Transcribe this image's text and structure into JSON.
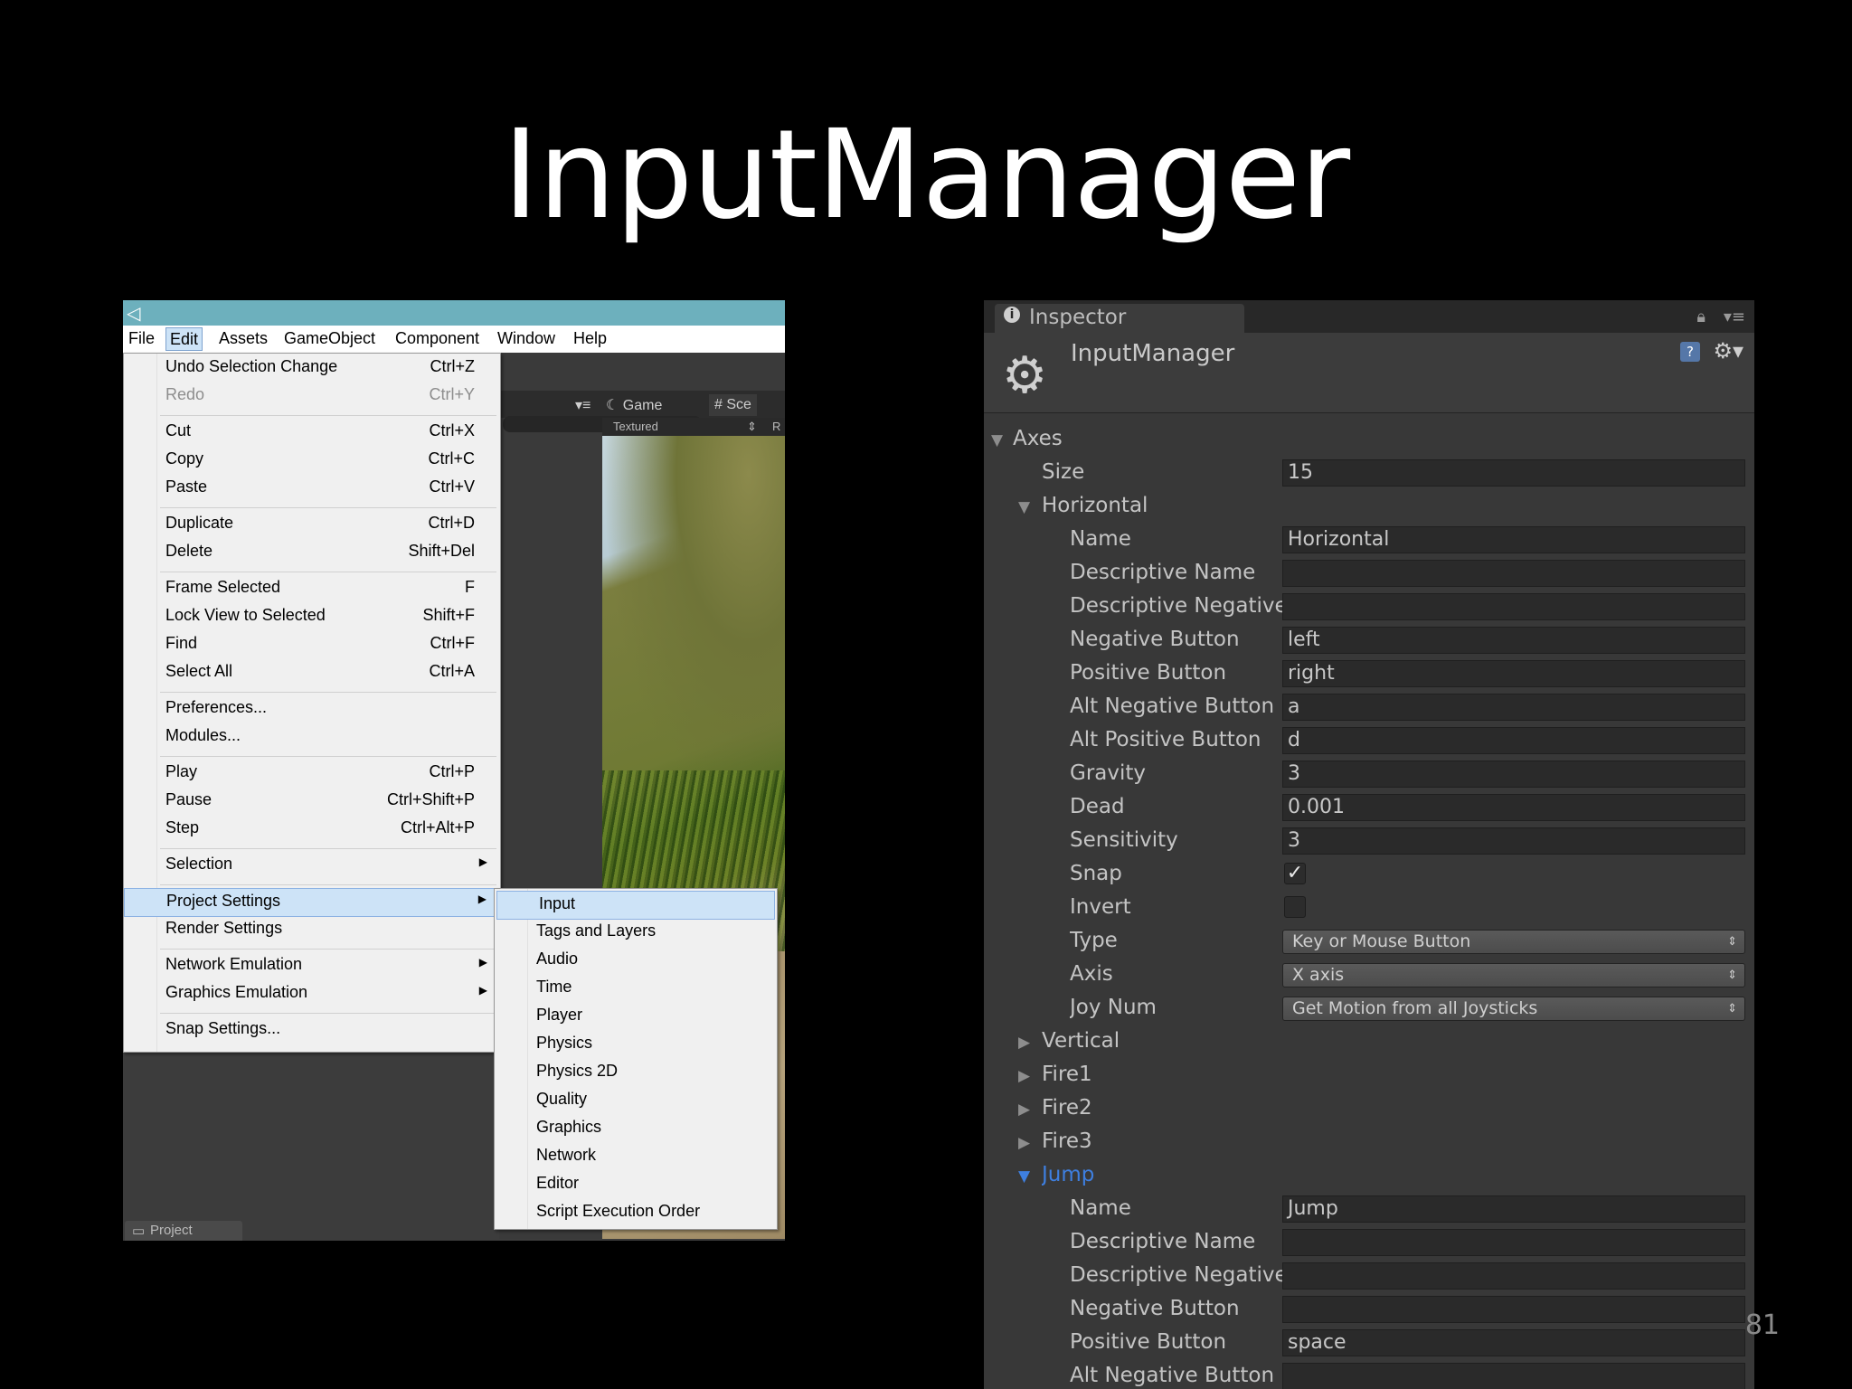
{
  "slide": {
    "title": "InputManager",
    "page_number": "81"
  },
  "unity_editor": {
    "menubar": [
      "File",
      "Edit",
      "Assets",
      "GameObject",
      "Component",
      "Window",
      "Help"
    ],
    "edit_menu": [
      {
        "label": "Undo Selection Change",
        "shortcut": "Ctrl+Z"
      },
      {
        "label": "Redo",
        "shortcut": "Ctrl+Y"
      },
      {
        "label": "Cut",
        "shortcut": "Ctrl+X"
      },
      {
        "label": "Copy",
        "shortcut": "Ctrl+C"
      },
      {
        "label": "Paste",
        "shortcut": "Ctrl+V"
      },
      {
        "label": "Duplicate",
        "shortcut": "Ctrl+D"
      },
      {
        "label": "Delete",
        "shortcut": "Shift+Del"
      },
      {
        "label": "Frame Selected",
        "shortcut": "F"
      },
      {
        "label": "Lock View to Selected",
        "shortcut": "Shift+F"
      },
      {
        "label": "Find",
        "shortcut": "Ctrl+F"
      },
      {
        "label": "Select All",
        "shortcut": "Ctrl+A"
      },
      {
        "label": "Preferences...",
        "shortcut": ""
      },
      {
        "label": "Modules...",
        "shortcut": ""
      },
      {
        "label": "Play",
        "shortcut": "Ctrl+P"
      },
      {
        "label": "Pause",
        "shortcut": "Ctrl+Shift+P"
      },
      {
        "label": "Step",
        "shortcut": "Ctrl+Alt+P"
      },
      {
        "label": "Selection",
        "shortcut": ""
      },
      {
        "label": "Project Settings",
        "shortcut": ""
      },
      {
        "label": "Render Settings",
        "shortcut": ""
      },
      {
        "label": "Network Emulation",
        "shortcut": ""
      },
      {
        "label": "Graphics Emulation",
        "shortcut": ""
      },
      {
        "label": "Snap Settings...",
        "shortcut": ""
      }
    ],
    "project_settings_menu": [
      "Input",
      "Tags and Layers",
      "Audio",
      "Time",
      "Player",
      "Physics",
      "Physics 2D",
      "Quality",
      "Graphics",
      "Network",
      "Editor",
      "Script Execution Order"
    ],
    "tabs": {
      "game": "Game",
      "scene": "Sce",
      "textured": "Textured",
      "r": "R"
    },
    "project_tab": "Project"
  },
  "inspector": {
    "tab_label": "Inspector",
    "object_name": "InputManager",
    "axes_label": "Axes",
    "size_label": "Size",
    "size_value": "15",
    "horizontal": {
      "header": "Horizontal",
      "name_label": "Name",
      "name": "Horizontal",
      "desc_name_label": "Descriptive Name",
      "desc_name": "",
      "desc_neg_label": "Descriptive Negative Name",
      "desc_neg": "",
      "neg_button_label": "Negative Button",
      "neg_button": "left",
      "pos_button_label": "Positive Button",
      "pos_button": "right",
      "alt_neg_label": "Alt Negative Button",
      "alt_neg": "a",
      "alt_pos_label": "Alt Positive Button",
      "alt_pos": "d",
      "gravity_label": "Gravity",
      "gravity": "3",
      "dead_label": "Dead",
      "dead": "0.001",
      "sensitivity_label": "Sensitivity",
      "sensitivity": "3",
      "snap_label": "Snap",
      "snap": true,
      "invert_label": "Invert",
      "invert": false,
      "type_label": "Type",
      "type": "Key or Mouse Button",
      "axis_label": "Axis",
      "axis": "X axis",
      "joy_label": "Joy Num",
      "joy": "Get Motion from all Joysticks"
    },
    "collapsed_axes": [
      "Vertical",
      "Fire1",
      "Fire2",
      "Fire3"
    ],
    "jump": {
      "header": "Jump",
      "name_label": "Name",
      "name": "Jump",
      "desc_name_label": "Descriptive Name",
      "desc_name": "",
      "desc_neg_label": "Descriptive Negative Name",
      "desc_neg": "",
      "neg_button_label": "Negative Button",
      "neg_button": "",
      "pos_button_label": "Positive Button",
      "pos_button": "space",
      "alt_neg_label": "Alt Negative Button",
      "alt_neg": ""
    },
    "colors": {
      "active_blue": "#3e7fe0",
      "panel": "#383838"
    }
  }
}
